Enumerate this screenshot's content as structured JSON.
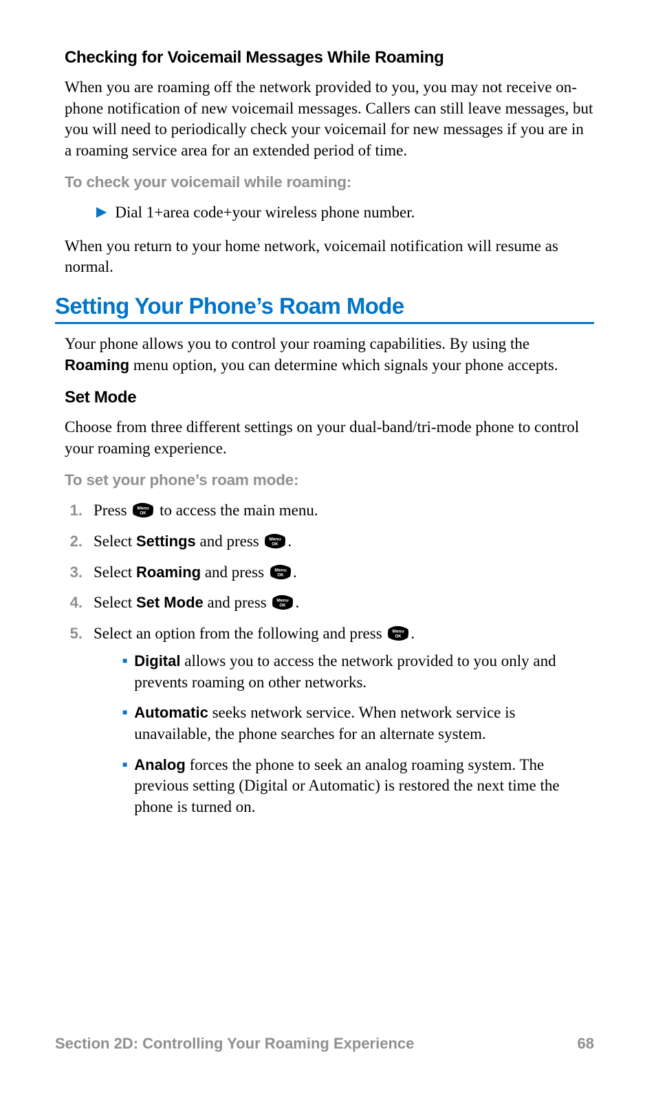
{
  "sec1": {
    "subhead": "Checking for Voicemail Messages While Roaming",
    "p1": "When you are roaming off the network provided to you, you may not receive on-phone notification of new voicemail messages. Callers can still leave messages, but you will need to periodically check your voicemail for new messages if you are in a roaming service area for an extended period of time.",
    "instr": "To check your voicemail while roaming:",
    "step": "Dial 1+area code+your wireless phone number.",
    "p2": "When you return to your home network, voicemail notification will resume as normal."
  },
  "sec2": {
    "heading": "Setting Your Phone’s Roam Mode",
    "intro_pre": "Your phone allows you to control your roaming capabilities. By using the ",
    "intro_bold": "Roaming",
    "intro_post": " menu option, you can determine which signals your phone accepts.",
    "subhead": "Set Mode",
    "p1": "Choose from three different settings on your dual-band/tri-mode phone to control your roaming experience.",
    "instr": "To set your phone’s roam mode:",
    "steps": {
      "s1_pre": "Press ",
      "s1_post": " to access the main menu.",
      "s2_pre": "Select ",
      "s2_bold": "Settings",
      "s2_mid": " and press ",
      "s3_pre": "Select ",
      "s3_bold": "Roaming",
      "s3_mid": " and press ",
      "s4_pre": "Select ",
      "s4_bold": "Set Mode",
      "s4_mid": " and press ",
      "s5_pre": "Select an option from the following and press ",
      "period": "."
    },
    "options": {
      "o1_bold": "Digital",
      "o1_rest": " allows you to access the network provided to you only and prevents roaming on other networks.",
      "o2_bold": "Automatic",
      "o2_rest": " seeks network service. When network service is unavailable, the phone searches for an alternate system.",
      "o3_bold": "Analog",
      "o3_rest": " forces the phone to seek an analog roaming system. The previous setting (Digital or Automatic) is restored the next time the phone is turned on."
    }
  },
  "footer": {
    "section": "Section 2D: Controlling Your Roaming Experience",
    "page": "68"
  },
  "nums": {
    "n1": "1.",
    "n2": "2.",
    "n3": "3.",
    "n4": "4.",
    "n5": "5."
  }
}
